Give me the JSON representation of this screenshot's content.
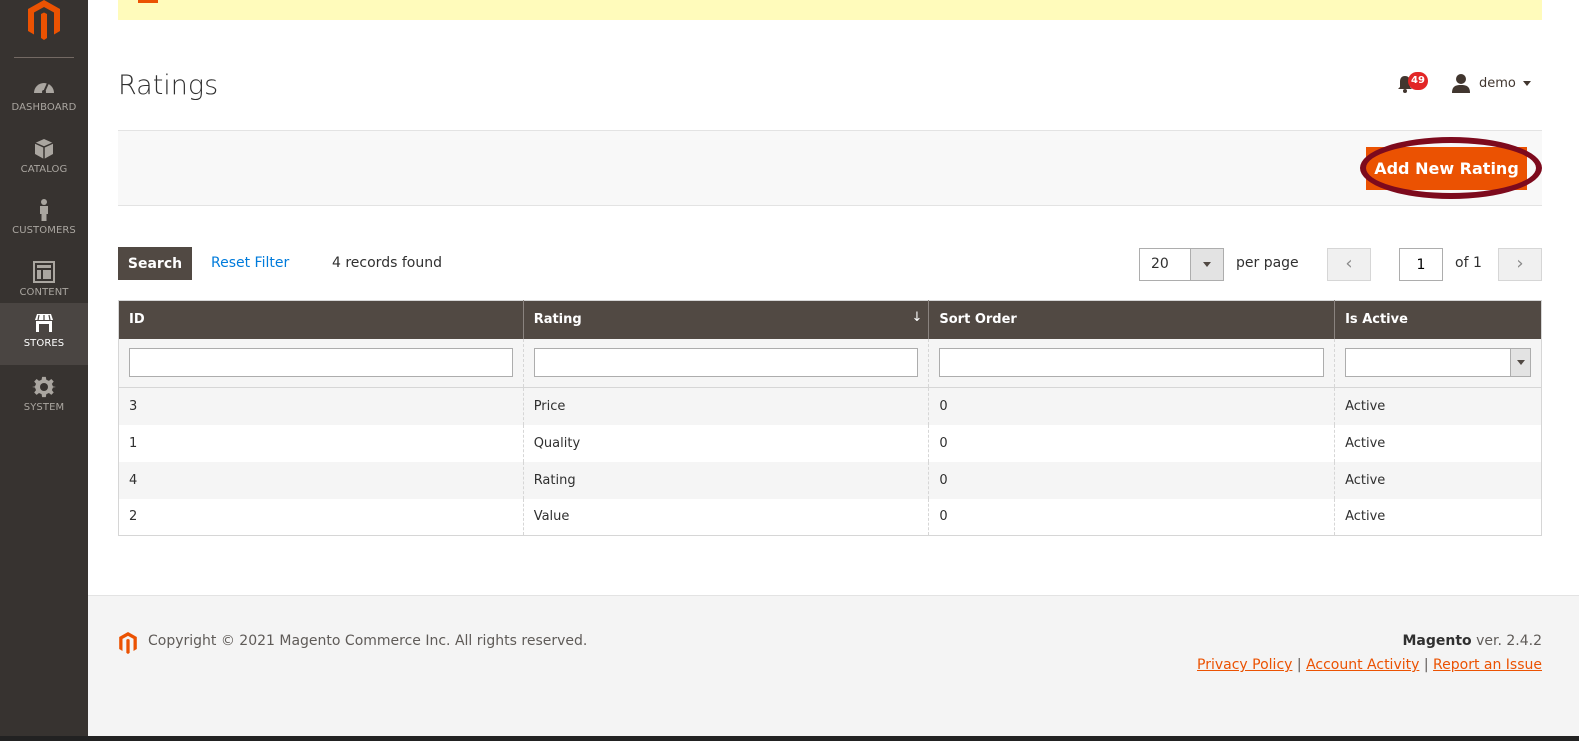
{
  "sidebar": {
    "items": [
      {
        "label": "DASHBOARD",
        "icon": "dashboard-icon",
        "active": false
      },
      {
        "label": "CATALOG",
        "icon": "catalog-box-icon",
        "active": false
      },
      {
        "label": "CUSTOMERS",
        "icon": "customer-person-icon",
        "active": false
      },
      {
        "label": "CONTENT",
        "icon": "content-layout-icon",
        "active": false
      },
      {
        "label": "STORES",
        "icon": "store-icon",
        "active": true
      },
      {
        "label": "SYSTEM",
        "icon": "gear-icon",
        "active": false
      }
    ]
  },
  "header": {
    "title": "Ratings",
    "notifications_count": "49",
    "username": "demo"
  },
  "actions": {
    "add_new_label": "Add New Rating"
  },
  "grid_toolbar": {
    "search_label": "Search",
    "reset_label": "Reset Filter",
    "records_found": "4 records found",
    "per_page_value": "20",
    "per_page_label": "per page",
    "current_page": "1",
    "of_pages": "of 1"
  },
  "table": {
    "columns": [
      "ID",
      "Rating",
      "Sort Order",
      "Is Active"
    ],
    "sorted_column": "Rating",
    "sort_indicator": "↓",
    "rows": [
      {
        "id": "3",
        "rating": "Price",
        "sort_order": "0",
        "is_active": "Active"
      },
      {
        "id": "1",
        "rating": "Quality",
        "sort_order": "0",
        "is_active": "Active"
      },
      {
        "id": "4",
        "rating": "Rating",
        "sort_order": "0",
        "is_active": "Active"
      },
      {
        "id": "2",
        "rating": "Value",
        "sort_order": "0",
        "is_active": "Active"
      }
    ]
  },
  "footer": {
    "copyright": "Copyright © 2021 Magento Commerce Inc. All rights reserved.",
    "brand": "Magento",
    "version": " ver. 2.4.2",
    "links": [
      "Privacy Policy",
      "Account Activity",
      "Report an Issue"
    ],
    "separator": " | "
  },
  "colors": {
    "accent": "#eb5202",
    "sidebar_bg": "#373330",
    "header_bg": "#514943",
    "highlight_ring": "#7d0a1d",
    "link": "#007bdb",
    "badge": "#e22626"
  }
}
